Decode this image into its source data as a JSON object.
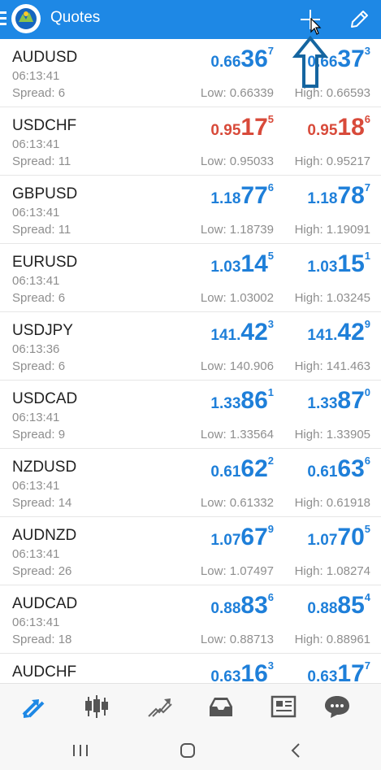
{
  "header": {
    "title": "Quotes",
    "icons": {
      "menu": "menu-icon",
      "logo": "app-logo",
      "add": "plus-icon",
      "edit": "pencil-icon"
    },
    "accent_color": "#1e88e5"
  },
  "quotes": [
    {
      "symbol": "AUDUSD",
      "time": "06:13:41",
      "spread": "Spread: 6",
      "low": "Low: 0.66339",
      "high": "High: 0.66593",
      "color": "blue",
      "bid": {
        "base": "0.66",
        "big": "36",
        "sup": "7"
      },
      "ask": {
        "base": "0.66",
        "big": "37",
        "sup": "3"
      }
    },
    {
      "symbol": "USDCHF",
      "time": "06:13:41",
      "spread": "Spread: 11",
      "low": "Low: 0.95033",
      "high": "High: 0.95217",
      "color": "red",
      "bid": {
        "base": "0.95",
        "big": "17",
        "sup": "5"
      },
      "ask": {
        "base": "0.95",
        "big": "18",
        "sup": "6"
      }
    },
    {
      "symbol": "GBPUSD",
      "time": "06:13:41",
      "spread": "Spread: 11",
      "low": "Low: 1.18739",
      "high": "High: 1.19091",
      "color": "blue",
      "bid": {
        "base": "1.18",
        "big": "77",
        "sup": "6"
      },
      "ask": {
        "base": "1.18",
        "big": "78",
        "sup": "7"
      }
    },
    {
      "symbol": "EURUSD",
      "time": "06:13:41",
      "spread": "Spread: 6",
      "low": "Low: 1.03002",
      "high": "High: 1.03245",
      "color": "blue",
      "bid": {
        "base": "1.03",
        "big": "14",
        "sup": "5"
      },
      "ask": {
        "base": "1.03",
        "big": "15",
        "sup": "1"
      }
    },
    {
      "symbol": "USDJPY",
      "time": "06:13:36",
      "spread": "Spread: 6",
      "low": "Low: 140.906",
      "high": "High: 141.463",
      "color": "blue",
      "bid": {
        "base": "141.",
        "big": "42",
        "sup": "3"
      },
      "ask": {
        "base": "141.",
        "big": "42",
        "sup": "9"
      }
    },
    {
      "symbol": "USDCAD",
      "time": "06:13:41",
      "spread": "Spread: 9",
      "low": "Low: 1.33564",
      "high": "High: 1.33905",
      "color": "blue",
      "bid": {
        "base": "1.33",
        "big": "86",
        "sup": "1"
      },
      "ask": {
        "base": "1.33",
        "big": "87",
        "sup": "0"
      }
    },
    {
      "symbol": "NZDUSD",
      "time": "06:13:41",
      "spread": "Spread: 14",
      "low": "Low: 0.61332",
      "high": "High: 0.61918",
      "color": "blue",
      "bid": {
        "base": "0.61",
        "big": "62",
        "sup": "2"
      },
      "ask": {
        "base": "0.61",
        "big": "63",
        "sup": "6"
      }
    },
    {
      "symbol": "AUDNZD",
      "time": "06:13:41",
      "spread": "Spread: 26",
      "low": "Low: 1.07497",
      "high": "High: 1.08274",
      "color": "blue",
      "bid": {
        "base": "1.07",
        "big": "67",
        "sup": "9"
      },
      "ask": {
        "base": "1.07",
        "big": "70",
        "sup": "5"
      }
    },
    {
      "symbol": "AUDCAD",
      "time": "06:13:41",
      "spread": "Spread: 18",
      "low": "Low: 0.88713",
      "high": "High: 0.88961",
      "color": "blue",
      "bid": {
        "base": "0.88",
        "big": "83",
        "sup": "6"
      },
      "ask": {
        "base": "0.88",
        "big": "85",
        "sup": "4"
      }
    },
    {
      "symbol": "AUDCHF",
      "time": "",
      "spread": "",
      "low": "",
      "high": "",
      "color": "blue",
      "bid": {
        "base": "0.63",
        "big": "16",
        "sup": "3"
      },
      "ask": {
        "base": "0.63",
        "big": "17",
        "sup": "7"
      }
    }
  ],
  "colors": {
    "blue": "#1e7fd9",
    "red": "#d84a3a"
  },
  "bottom_nav": [
    {
      "name": "quotes-tab",
      "icon": "arrows-icon",
      "active": true
    },
    {
      "name": "chart-tab",
      "icon": "candlestick-icon",
      "active": false
    },
    {
      "name": "trade-tab",
      "icon": "trend-icon",
      "active": false
    },
    {
      "name": "history-tab",
      "icon": "inbox-icon",
      "active": false
    },
    {
      "name": "news-tab",
      "icon": "newspaper-icon",
      "active": false
    },
    {
      "name": "messages-tab",
      "icon": "chat-icon",
      "active": false
    }
  ],
  "system_nav": [
    "recent-apps-icon",
    "home-icon",
    "back-icon"
  ]
}
